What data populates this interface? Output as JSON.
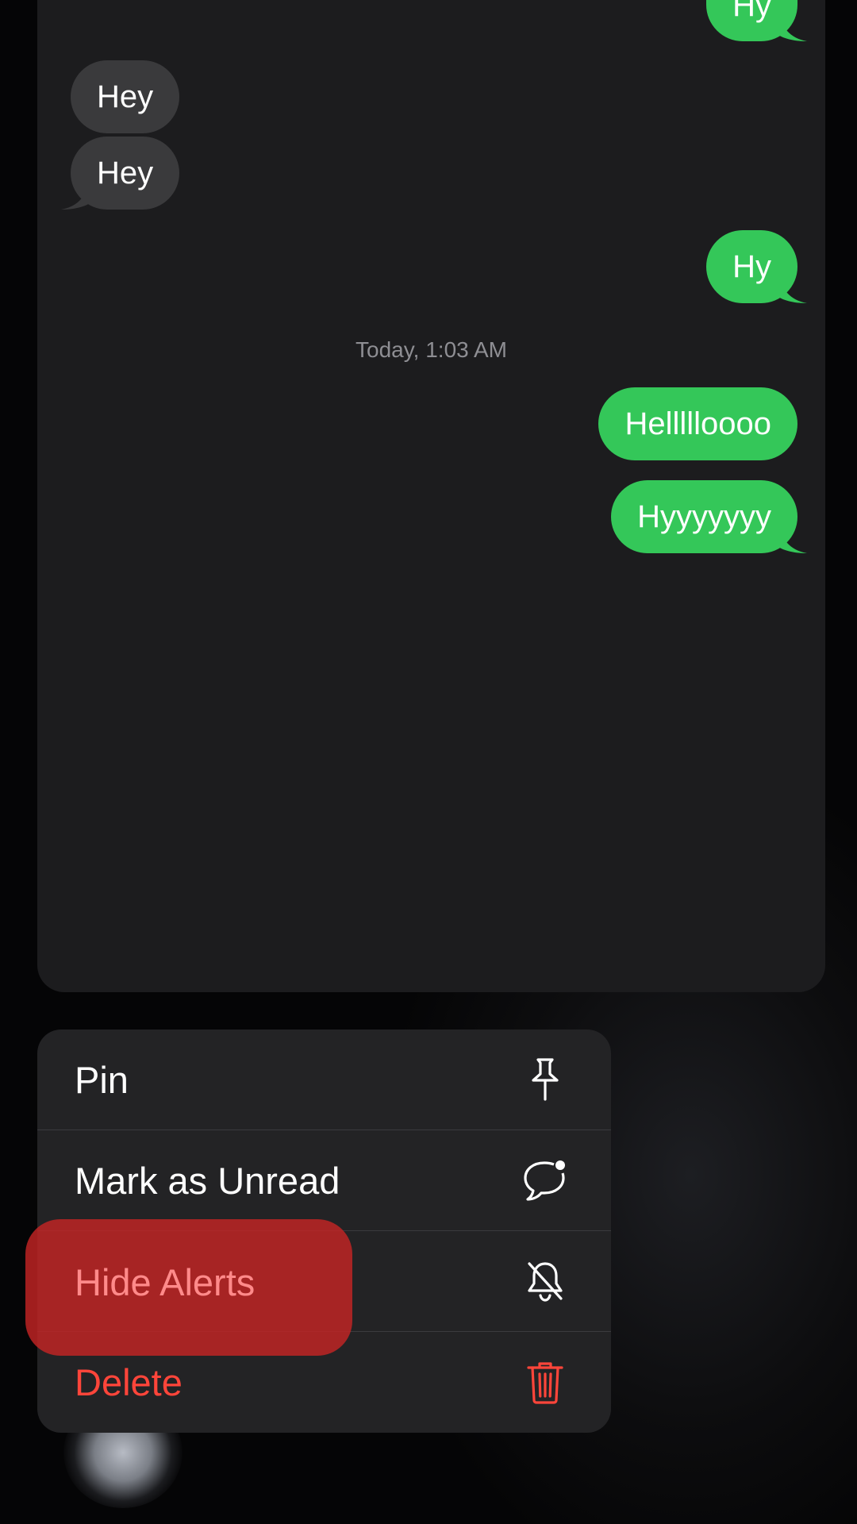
{
  "conversation": {
    "messages": [
      {
        "text": "Hy",
        "direction": "out"
      },
      {
        "text": "Hey",
        "direction": "in"
      },
      {
        "text": "Hey",
        "direction": "in"
      },
      {
        "text": "Hy",
        "direction": "out"
      },
      {
        "text": "Hellllloooo",
        "direction": "out"
      },
      {
        "text": "Hyyyyyyy",
        "direction": "out"
      }
    ],
    "timestamp": "Today, 1:03 AM"
  },
  "menu": {
    "items": [
      {
        "label": "Pin",
        "icon": "pin-icon",
        "destructive": false
      },
      {
        "label": "Mark as Unread",
        "icon": "unread-bubble-icon",
        "destructive": false
      },
      {
        "label": "Hide Alerts",
        "icon": "bell-slash-icon",
        "destructive": false
      },
      {
        "label": "Delete",
        "icon": "trash-icon",
        "destructive": true
      }
    ]
  },
  "colors": {
    "incoming_bubble": "#3a3a3c",
    "outgoing_bubble": "#34c759",
    "destructive": "#ff453a",
    "highlight": "#c82424"
  }
}
